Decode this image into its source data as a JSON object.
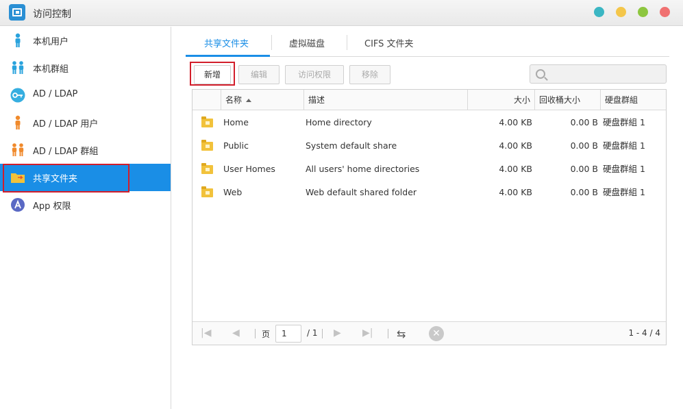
{
  "window": {
    "title": "访问控制",
    "window_dots": [
      {
        "name": "teal",
        "color": "#3bb6c3"
      },
      {
        "name": "yellow",
        "color": "#f4c64a"
      },
      {
        "name": "green",
        "color": "#8dc63f"
      },
      {
        "name": "red",
        "color": "#f07171"
      }
    ]
  },
  "sidebar": {
    "items": [
      {
        "label": "本机用户",
        "icon": "user-icon"
      },
      {
        "label": "本机群組",
        "icon": "group-icon"
      },
      {
        "label": "AD / LDAP",
        "icon": "key-icon"
      },
      {
        "label": "AD / LDAP 用户",
        "icon": "ldap-user-icon"
      },
      {
        "label": "AD / LDAP 群組",
        "icon": "ldap-group-icon"
      },
      {
        "label": "共享文件夹",
        "icon": "shared-folder-icon",
        "active": true
      },
      {
        "label": "App 权限",
        "icon": "app-icon"
      }
    ]
  },
  "tabs": [
    {
      "label": "共享文件夹",
      "active": true
    },
    {
      "label": "虚拟磁盘"
    },
    {
      "label": "CIFS 文件夹"
    }
  ],
  "toolbar": {
    "new_label": "新增",
    "edit_label": "编辑",
    "permission_label": "访问权限",
    "remove_label": "移除"
  },
  "search": {
    "placeholder": ""
  },
  "table": {
    "columns": {
      "name": "名称",
      "description": "描述",
      "size": "大小",
      "recycle_size": "回收桶大小",
      "disk_group": "硬盘群組"
    },
    "rows": [
      {
        "name": "Home",
        "description": "Home directory",
        "size": "4.00 KB",
        "recycle_size": "0.00 B",
        "disk_group": "硬盘群組 1"
      },
      {
        "name": "Public",
        "description": "System default share",
        "size": "4.00 KB",
        "recycle_size": "0.00 B",
        "disk_group": "硬盘群組 1"
      },
      {
        "name": "User Homes",
        "description": "All users' home directories",
        "size": "4.00 KB",
        "recycle_size": "0.00 B",
        "disk_group": "硬盘群組 1"
      },
      {
        "name": "Web",
        "description": "Web default shared folder",
        "size": "4.00 KB",
        "recycle_size": "0.00 B",
        "disk_group": "硬盘群組 1"
      }
    ]
  },
  "pager": {
    "page_label": "页",
    "page_value": "1",
    "total_pages": "/ 1",
    "range": "1 - 4 / 4"
  },
  "colors": {
    "accent": "#1a8ee6",
    "highlight": "#d21d2a"
  }
}
